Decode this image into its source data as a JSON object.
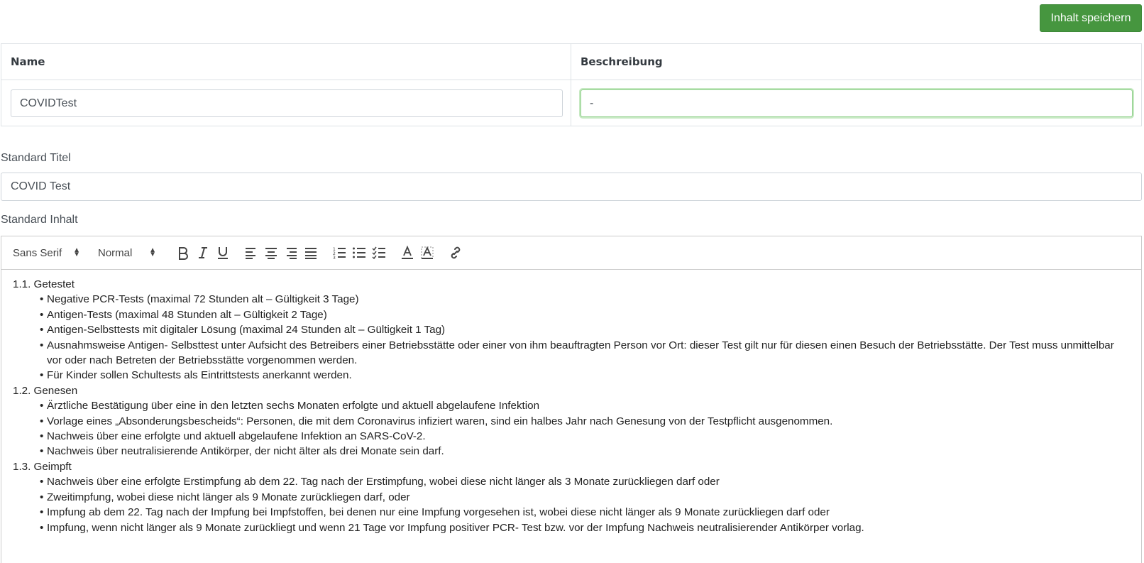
{
  "toolbar_top": {
    "save_label": "Inhalt speichern"
  },
  "table": {
    "headers": [
      "Name",
      "Beschreibung"
    ],
    "name_value": "COVIDTest",
    "description_value": "-"
  },
  "standard_title": {
    "label": "Standard Titel",
    "value": "COVID Test"
  },
  "standard_content": {
    "label": "Standard Inhalt",
    "toolbar": {
      "font": "Sans Serif",
      "size": "Normal"
    },
    "sections": [
      {
        "title": "1.1. Getestet",
        "items": [
          "Negative PCR-Tests (maximal 72 Stunden alt – Gültigkeit 3 Tage)",
          "Antigen-Tests (maximal 48 Stunden alt – Gültigkeit 2 Tage)",
          "Antigen-Selbsttests mit digitaler Lösung (maximal 24 Stunden alt – Gültigkeit 1 Tag)",
          "Ausnahmsweise Antigen- Selbsttest unter Aufsicht des Betreibers einer Betriebsstätte oder einer von ihm beauftragten Person vor Ort: dieser Test gilt nur für diesen einen Besuch der Betriebsstätte. Der Test muss unmittelbar vor oder nach Betreten der Betriebsstätte vorgenommen werden.",
          "Für Kinder sollen Schultests als Eintrittstests anerkannt werden."
        ]
      },
      {
        "title": "1.2. Genesen",
        "items": [
          "Ärztliche Bestätigung über eine in den letzten sechs Monaten erfolgte und aktuell abgelaufene Infektion",
          "Vorlage eines „Absonderungsbescheids“: Personen, die mit dem Coronavirus infiziert waren, sind ein halbes Jahr nach Genesung von der Testpflicht ausgenommen.",
          "Nachweis über eine erfolgte und aktuell abgelaufene Infektion an SARS-CoV-2.",
          "Nachweis über neutralisierende Antikörper, der nicht älter als drei Monate sein darf."
        ]
      },
      {
        "title": "1.3. Geimpft",
        "items": [
          "Nachweis über eine erfolgte Erstimpfung ab dem 22. Tag nach der Erstimpfung, wobei diese nicht länger als 3 Monate zurückliegen darf oder",
          "Zweitimpfung, wobei diese nicht länger als 9 Monate zurückliegen darf, oder",
          "Impfung ab dem 22. Tag nach der Impfung bei Impfstoffen, bei denen nur eine Impfung vorgesehen ist, wobei diese nicht länger als 9 Monate zurückliegen darf oder",
          "Impfung, wenn nicht länger als 9 Monate zurückliegt und wenn 21 Tage vor Impfung positiver PCR- Test bzw. vor der Impfung Nachweis neutralisierender Antikörper vorlag."
        ]
      }
    ]
  }
}
